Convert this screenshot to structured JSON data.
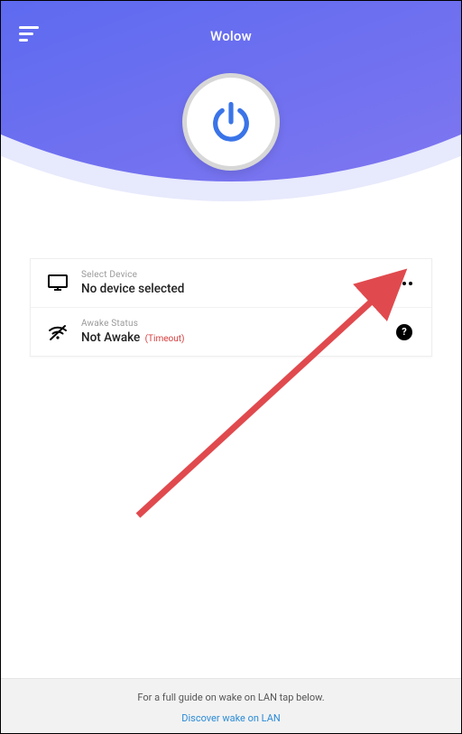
{
  "app": {
    "title": "Wolow"
  },
  "card": {
    "device": {
      "label": "Select Device",
      "value": "No device selected"
    },
    "status": {
      "label": "Awake Status",
      "value": "Not Awake",
      "suffix": "(Timeout)"
    },
    "help_symbol": "?"
  },
  "footer": {
    "guide_text": "For a full guide on wake on LAN tap below.",
    "link_text": "Discover wake on LAN"
  }
}
